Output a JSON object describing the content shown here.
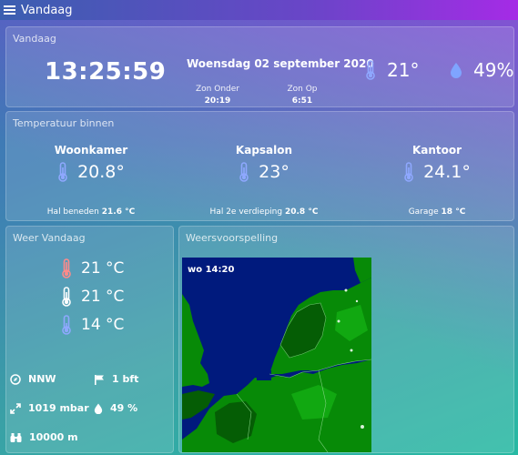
{
  "header": {
    "title": "Vandaag"
  },
  "vandaag": {
    "title": "Vandaag",
    "time": "13:25:59",
    "date": "Woensdag 02 september 2020",
    "sun_down_label": "Zon Onder",
    "sun_down_time": "20:19",
    "sun_up_label": "Zon Op",
    "sun_up_time": "6:51",
    "temperature": "21°",
    "humidity": "49%"
  },
  "binnen": {
    "title": "Temperatuur binnen",
    "rooms": [
      {
        "name": "Woonkamer",
        "temp": "20.8°"
      },
      {
        "name": "Kapsalon",
        "temp": "23°"
      },
      {
        "name": "Kantoor",
        "temp": "24.1°"
      }
    ],
    "extra": [
      {
        "label": "Hal beneden",
        "value": "21.6 °C"
      },
      {
        "label": "Hal 2e verdieping",
        "value": "20.8 °C"
      },
      {
        "label": "Garage",
        "value": "18 °C"
      }
    ]
  },
  "weer": {
    "title": "Weer Vandaag",
    "temps": [
      "21 °C",
      "21 °C",
      "14 °C"
    ],
    "wind_direction": "NNW",
    "wind_force": "1 bft",
    "pressure": "1019 mbar",
    "humidity": "49 %",
    "visibility": "10000 m"
  },
  "voorspelling": {
    "title": "Weersvoorspelling",
    "map_time": "wo 14:20"
  },
  "colors": {
    "thermometer": "#8fa8ff",
    "thermometer_hot": "#ff8a8a",
    "droplet": "#7fa4ff",
    "sea": "#001a7d",
    "land": "#078a07",
    "land_dark": "#055d05",
    "land_light": "#11a811"
  },
  "icons": {
    "menu": "menu-icon",
    "thermometer": "thermometer-icon",
    "humidity": "droplet-icon",
    "wind_direction": "compass-icon",
    "wind_force": "flag-icon",
    "pressure": "pressure-icon",
    "humidity_small": "droplet-icon",
    "visibility": "binoculars-icon"
  }
}
